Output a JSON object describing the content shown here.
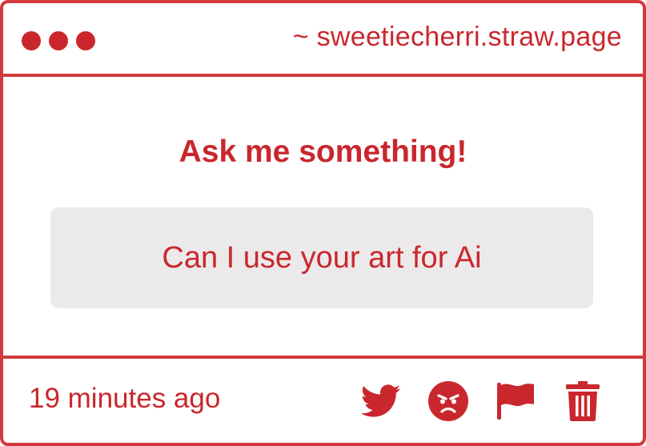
{
  "window": {
    "url": "~ sweetiecherri.straw.page",
    "controls": [
      "dot",
      "dot",
      "dot"
    ]
  },
  "main": {
    "heading": "Ask me something!",
    "question": "Can I use your art for Ai"
  },
  "footer": {
    "timestamp": "19 minutes ago",
    "actions": [
      {
        "name": "twitter-icon"
      },
      {
        "name": "angry-face-icon"
      },
      {
        "name": "flag-icon"
      },
      {
        "name": "trash-icon"
      }
    ]
  },
  "colors": {
    "accent": "#c9272d",
    "border": "#d23a3f",
    "question_background": "#ece9ea",
    "background": "#ffffff"
  }
}
